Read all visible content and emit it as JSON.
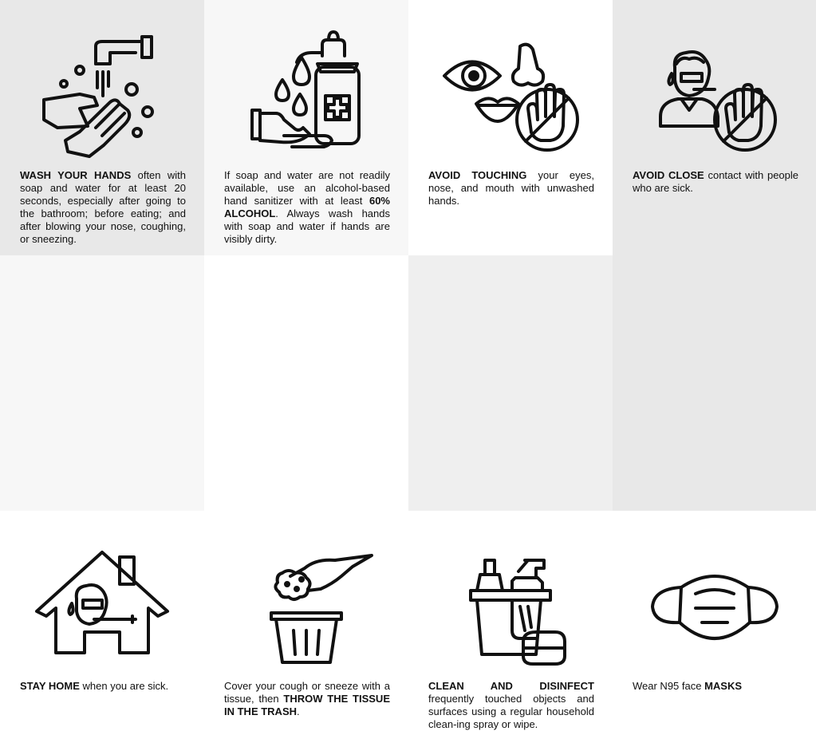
{
  "tips": [
    {
      "icon": "hand-washing-icon",
      "parts": [
        {
          "bold": "WASH YOUR HANDS"
        },
        {
          "text": " often with soap and water for at least 20 seconds, especially after going to the bathroom; before eating; and after blowing your nose, coughing, or sneezing."
        }
      ]
    },
    {
      "icon": "hand-sanitizer-icon",
      "parts": [
        {
          "text": "If soap and water are not readily available, use an alcohol-based hand sanitizer with at least "
        },
        {
          "bold": "60% ALCOHOL"
        },
        {
          "text": ". Always wash hands with soap and water if hands are visibly dirty."
        }
      ]
    },
    {
      "icon": "no-touching-face-icon",
      "parts": [
        {
          "bold": "AVOID TOUCHING"
        },
        {
          "text": " your eyes, nose, and mouth with unwashed hands."
        }
      ]
    },
    {
      "icon": "avoid-sick-person-icon",
      "parts": [
        {
          "bold": "AVOID CLOSE"
        },
        {
          "text": " contact with people who are sick."
        }
      ]
    },
    {
      "icon": "stay-home-icon",
      "parts": [
        {
          "bold": "STAY HOME"
        },
        {
          "text": " when you are sick."
        }
      ]
    },
    {
      "icon": "tissue-trash-icon",
      "parts": [
        {
          "text": "Cover your cough or sneeze with a tissue, then "
        },
        {
          "bold": "THROW THE TISSUE IN THE TRASH"
        },
        {
          "text": "."
        }
      ]
    },
    {
      "icon": "cleaning-supplies-icon",
      "parts": [
        {
          "bold": "CLEAN AND DISINFECT"
        },
        {
          "text": " frequently touched objects and surfaces using a regular household clean-ing spray or wipe."
        }
      ]
    },
    {
      "icon": "face-mask-icon",
      "parts": [
        {
          "text": "Wear N95 face "
        },
        {
          "bold": "MASKS"
        }
      ]
    }
  ],
  "colors": {
    "ink": "#111111",
    "bg_dark": "#e8e8e8",
    "bg_light": "#f7f7f7",
    "bg_white": "#ffffff"
  }
}
